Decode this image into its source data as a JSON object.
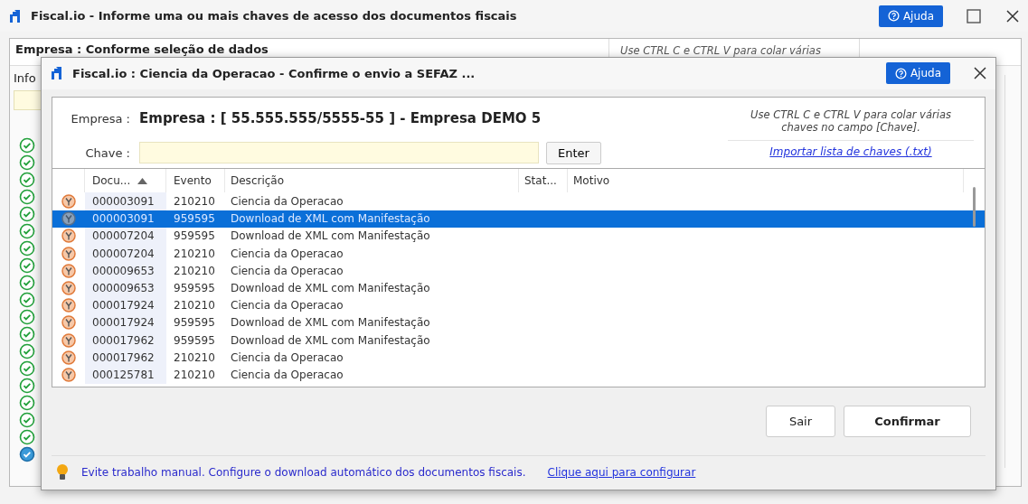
{
  "background_window": {
    "title": "Fiscal.io - Informe uma ou mais chaves de acesso dos documentos fiscais",
    "help_button": "Ajuda",
    "company_label": "Empresa : Conforme seleção de dados",
    "hint": "Use CTRL C e CTRL V para colar várias",
    "info_label": "Info",
    "status_rows": [
      {
        "selected": false
      },
      {
        "selected": false
      },
      {
        "selected": false
      },
      {
        "selected": false
      },
      {
        "selected": false
      },
      {
        "selected": false
      },
      {
        "selected": false
      },
      {
        "selected": false
      },
      {
        "selected": false
      },
      {
        "selected": false
      },
      {
        "selected": false
      },
      {
        "selected": false
      },
      {
        "selected": false
      },
      {
        "selected": false
      },
      {
        "selected": false
      },
      {
        "selected": false
      },
      {
        "selected": false
      },
      {
        "selected": false
      },
      {
        "selected": true
      }
    ]
  },
  "dialog": {
    "title": "Fiscal.io : Ciencia da Operacao - Confirme o envio a SEFAZ ...",
    "help_button": "Ajuda",
    "company_label": "Empresa :",
    "company_value": "Empresa : [ 55.555.555/5555-55 ] - Empresa DEMO 5",
    "key_label": "Chave :",
    "enter_button": "Enter",
    "hint": "Use CTRL C e CTRL V para colar várias chaves no campo [Chave].",
    "import_link": "Importar lista de chaves (.txt)",
    "table": {
      "columns": [
        {
          "label": "Docu...",
          "sorted": true
        },
        {
          "label": "Evento",
          "sorted": false
        },
        {
          "label": "Descrição",
          "sorted": false
        },
        {
          "label": "Stat...",
          "sorted": false
        },
        {
          "label": "Motivo",
          "sorted": false
        }
      ],
      "rows": [
        {
          "document": "000003091",
          "event": "210210",
          "description": "Ciencia da Operacao",
          "selected": false
        },
        {
          "document": "000003091",
          "event": "959595",
          "description": "Download de XML com Manifestação",
          "selected": true
        },
        {
          "document": "000007204",
          "event": "959595",
          "description": "Download de XML com Manifestação",
          "selected": false
        },
        {
          "document": "000007204",
          "event": "210210",
          "description": "Ciencia da Operacao",
          "selected": false
        },
        {
          "document": "000009653",
          "event": "210210",
          "description": "Ciencia da Operacao",
          "selected": false
        },
        {
          "document": "000009653",
          "event": "959595",
          "description": "Download de XML com Manifestação",
          "selected": false
        },
        {
          "document": "000017924",
          "event": "210210",
          "description": "Ciencia da Operacao",
          "selected": false
        },
        {
          "document": "000017924",
          "event": "959595",
          "description": "Download de XML com Manifestação",
          "selected": false
        },
        {
          "document": "000017962",
          "event": "959595",
          "description": "Download de XML com Manifestação",
          "selected": false
        },
        {
          "document": "000017962",
          "event": "210210",
          "description": "Ciencia da Operacao",
          "selected": false
        },
        {
          "document": "000125781",
          "event": "210210",
          "description": "Ciencia da Operacao",
          "selected": false
        }
      ]
    },
    "buttons": [
      {
        "label": "Sair",
        "kind": "secondary"
      },
      {
        "label": "Confirmar",
        "kind": "primary"
      }
    ],
    "footer": {
      "message": "Evite trabalho manual. Configure o download automático dos documentos fiscais.",
      "link": "Clique aqui para configurar"
    }
  }
}
